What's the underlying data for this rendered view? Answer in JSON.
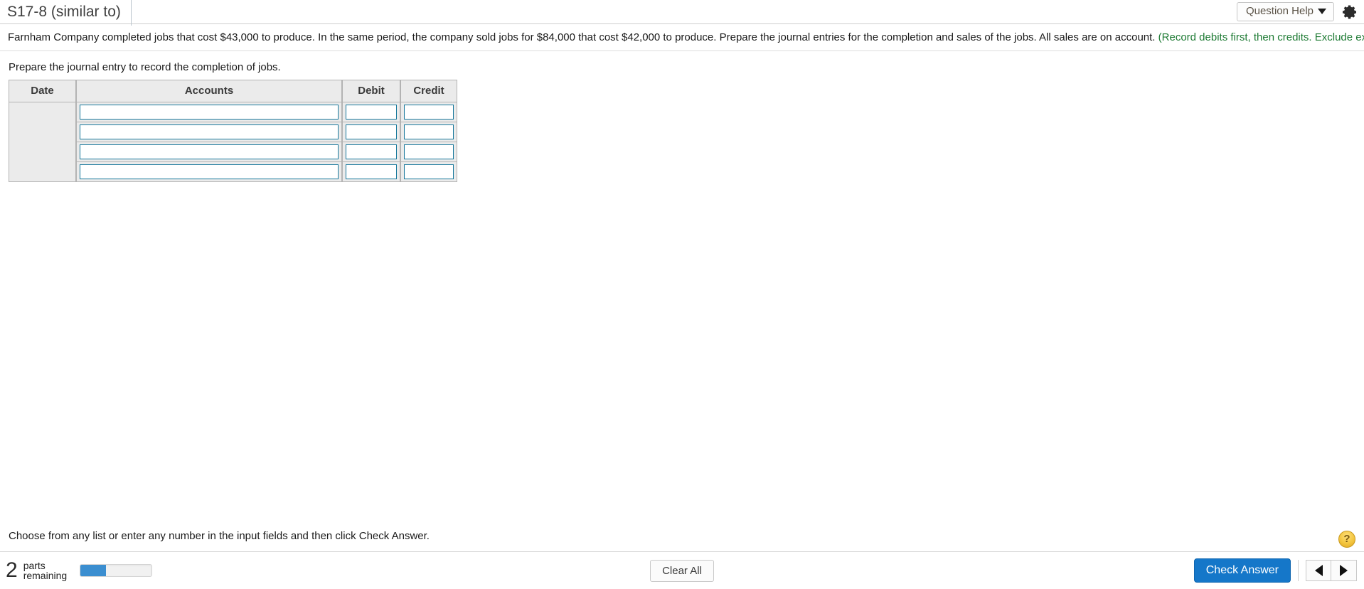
{
  "header": {
    "question_id": "S17-8 (similar to)",
    "question_help_label": "Question Help",
    "gear_icon": "gear-icon",
    "caret_icon": "chevron-down-icon"
  },
  "statement": {
    "text": "Farnham Company completed jobs that cost $43,000 to produce. In the same period, the company sold jobs for $84,000 that cost $42,000 to produce. Prepare the journal entries for the completion and sales of the jobs. All sales are on account. ",
    "hint": "(Record debits first, then credits. Exclude explanations from any journal entries.)"
  },
  "part": {
    "prompt": "Prepare the journal entry to record the completion of jobs."
  },
  "journal": {
    "columns": [
      "Date",
      "Accounts",
      "Debit",
      "Credit"
    ],
    "rows": [
      {
        "date": "",
        "accounts": "",
        "debit": "",
        "credit": ""
      },
      {
        "date": "",
        "accounts": "",
        "debit": "",
        "credit": ""
      },
      {
        "date": "",
        "accounts": "",
        "debit": "",
        "credit": ""
      },
      {
        "date": "",
        "accounts": "",
        "debit": "",
        "credit": ""
      }
    ]
  },
  "bottom": {
    "instruction": "Choose from any list or enter any number in the input fields and then click Check Answer.",
    "help_icon_label": "?"
  },
  "footer": {
    "parts_count": "2",
    "parts_label_line1": "parts",
    "parts_label_line2": "remaining",
    "progress_percent": 36,
    "clear_all_label": "Clear All",
    "check_answer_label": "Check Answer",
    "prev_icon": "triangle-left-icon",
    "next_icon": "triangle-right-icon"
  },
  "colors": {
    "accent_blue": "#1577c9",
    "input_border_teal": "#17789c",
    "hint_green": "#1d7a33",
    "progress_blue": "#3b8ed0",
    "help_gold": "#f3c53f"
  }
}
